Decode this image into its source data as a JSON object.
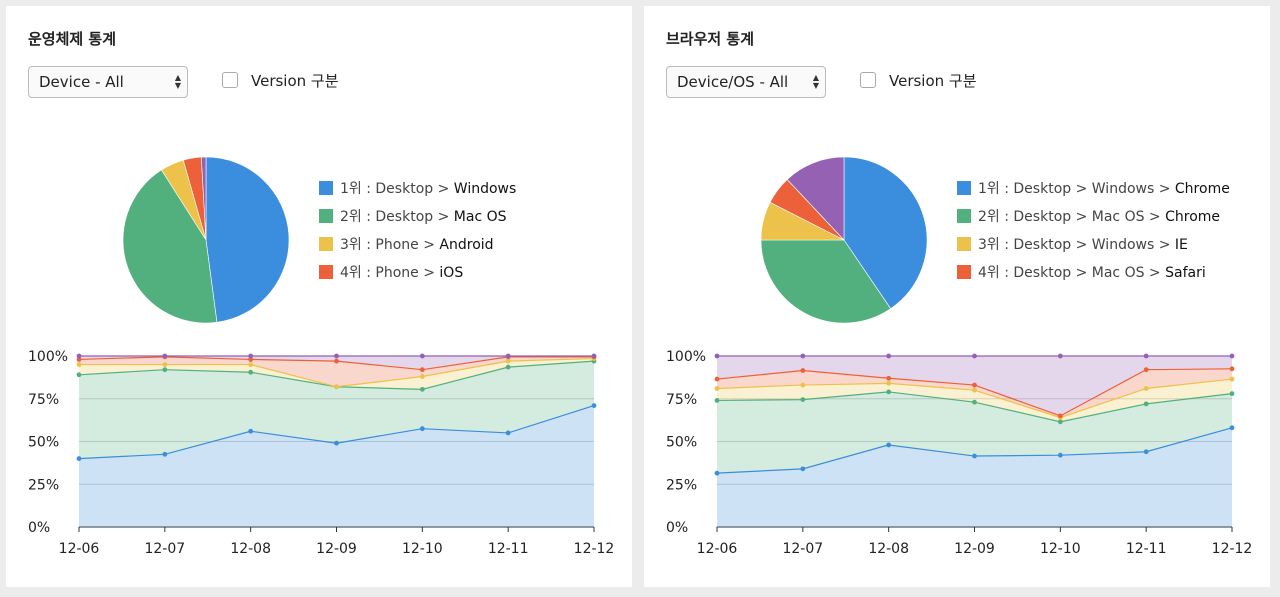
{
  "panels": [
    {
      "title": "운영체제 통계",
      "select_value": "Device - All",
      "checkbox_label": "Version 구분",
      "pie": [
        47.9,
        43.1,
        4.6,
        3.5,
        0.9
      ],
      "pie_colors": [
        "#3b8ddd",
        "#52b07f",
        "#ecc24a",
        "#ec6139",
        "#9461b3"
      ],
      "legend": [
        {
          "rank": "1위 : Desktop > ",
          "name": "Windows",
          "color": "#3b8ddd"
        },
        {
          "rank": "2위 : Desktop > ",
          "name": "Mac OS",
          "color": "#52b07f"
        },
        {
          "rank": "3위 : Phone > ",
          "name": "Android",
          "color": "#ecc24a"
        },
        {
          "rank": "4위 : Phone > ",
          "name": "iOS",
          "color": "#ec6139"
        }
      ],
      "chart_data": {
        "type": "area",
        "stacked": true,
        "categories": [
          "12-06",
          "12-07",
          "12-08",
          "12-09",
          "12-10",
          "12-11",
          "12-12"
        ],
        "yticks": [
          "0%",
          "25%",
          "50%",
          "75%",
          "100%"
        ],
        "ylim": [
          0,
          100
        ],
        "cumulative": [
          [
            40,
            42.5,
            56,
            49,
            57.5,
            55,
            71
          ],
          [
            89,
            92,
            90.5,
            82,
            80.5,
            93.5,
            97
          ],
          [
            95,
            95,
            95,
            82,
            88,
            97,
            98.5
          ],
          [
            98,
            99.5,
            98,
            97,
            92,
            99.5,
            99.5
          ],
          [
            100,
            100,
            100,
            100,
            100,
            100,
            100
          ]
        ],
        "colors": [
          "#3b8ddd",
          "#52b07f",
          "#ecc24a",
          "#ec6139",
          "#9461b3"
        ]
      }
    },
    {
      "title": "브라우저 통계",
      "select_value": "Device/OS - All",
      "checkbox_label": "Version 구분",
      "pie": [
        40.5,
        34.5,
        7.5,
        5.5,
        12.0
      ],
      "pie_colors": [
        "#3b8ddd",
        "#52b07f",
        "#ecc24a",
        "#ec6139",
        "#9461b3"
      ],
      "legend": [
        {
          "rank": "1위 : Desktop > Windows > ",
          "name": "Chrome",
          "color": "#3b8ddd"
        },
        {
          "rank": "2위 : Desktop > Mac OS > ",
          "name": "Chrome",
          "color": "#52b07f"
        },
        {
          "rank": "3위 : Desktop > Windows > ",
          "name": "IE",
          "color": "#ecc24a"
        },
        {
          "rank": "4위 : Desktop > Mac OS > ",
          "name": "Safari",
          "color": "#ec6139"
        }
      ],
      "chart_data": {
        "type": "area",
        "stacked": true,
        "categories": [
          "12-06",
          "12-07",
          "12-08",
          "12-09",
          "12-10",
          "12-11",
          "12-12"
        ],
        "yticks": [
          "0%",
          "25%",
          "50%",
          "75%",
          "100%"
        ],
        "ylim": [
          0,
          100
        ],
        "cumulative": [
          [
            31.5,
            34,
            48,
            41.5,
            42,
            44,
            58
          ],
          [
            74,
            74.5,
            79,
            73,
            61.5,
            72,
            78
          ],
          [
            81,
            83,
            84,
            80,
            64,
            81,
            86.5
          ],
          [
            86.5,
            91.5,
            87,
            83,
            65,
            92,
            92.5
          ],
          [
            100,
            100,
            100,
            100,
            100,
            100,
            100
          ]
        ],
        "colors": [
          "#3b8ddd",
          "#52b07f",
          "#ecc24a",
          "#ec6139",
          "#9461b3"
        ]
      }
    }
  ]
}
